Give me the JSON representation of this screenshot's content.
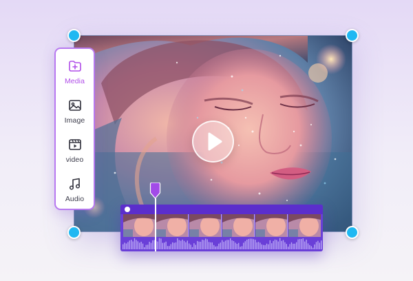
{
  "tool_panel": {
    "items": [
      {
        "label": "Media",
        "icon": "media-icon",
        "active": true
      },
      {
        "label": "Image",
        "icon": "image-icon",
        "active": false
      },
      {
        "label": "video",
        "icon": "video-icon",
        "active": false
      },
      {
        "label": "Audio",
        "icon": "audio-icon",
        "active": false
      }
    ]
  },
  "preview": {
    "play_icon": "play-icon"
  },
  "timeline": {
    "frame_count": 6,
    "waveform": "audio-waveform"
  },
  "colors": {
    "accent_purple": "#b778f0",
    "active_label": "#b04ee8",
    "timeline_bg": "#6a3fd8",
    "handle": "#1fb8f2"
  }
}
